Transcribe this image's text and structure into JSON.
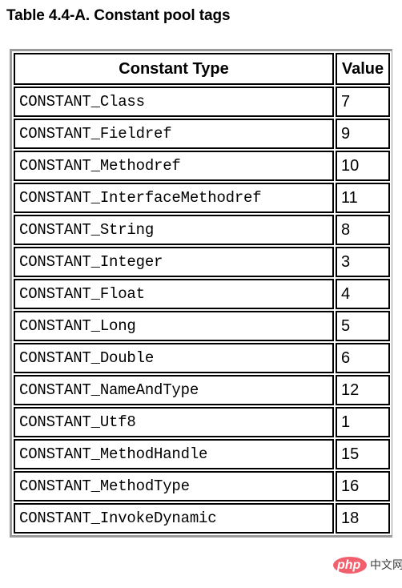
{
  "page": {
    "title": "Table 4.4-A. Constant pool tags",
    "background_color": "#ffffff",
    "text_color": "#000000",
    "border_color": "#000000",
    "frame_color": "#9a9a9a"
  },
  "table": {
    "columns": [
      {
        "key": "type",
        "label": "Constant Type"
      },
      {
        "key": "value",
        "label": "Value"
      }
    ],
    "rows": [
      {
        "type": "CONSTANT_Class",
        "value": "7"
      },
      {
        "type": "CONSTANT_Fieldref",
        "value": "9"
      },
      {
        "type": "CONSTANT_Methodref",
        "value": "10"
      },
      {
        "type": "CONSTANT_InterfaceMethodref",
        "value": "11"
      },
      {
        "type": "CONSTANT_String",
        "value": "8"
      },
      {
        "type": "CONSTANT_Integer",
        "value": "3"
      },
      {
        "type": "CONSTANT_Float",
        "value": "4"
      },
      {
        "type": "CONSTANT_Long",
        "value": "5"
      },
      {
        "type": "CONSTANT_Double",
        "value": "6"
      },
      {
        "type": "CONSTANT_NameAndType",
        "value": "12"
      },
      {
        "type": "CONSTANT_Utf8",
        "value": "1"
      },
      {
        "type": "CONSTANT_MethodHandle",
        "value": "15"
      },
      {
        "type": "CONSTANT_MethodType",
        "value": "16"
      },
      {
        "type": "CONSTANT_InvokeDynamic",
        "value": "18"
      }
    ]
  },
  "watermark": {
    "brand": "php",
    "suffix": "中文网",
    "ellipse_color": "#ef4a58",
    "brand_color": "#ffffff",
    "suffix_color": "#3a3a3a"
  }
}
